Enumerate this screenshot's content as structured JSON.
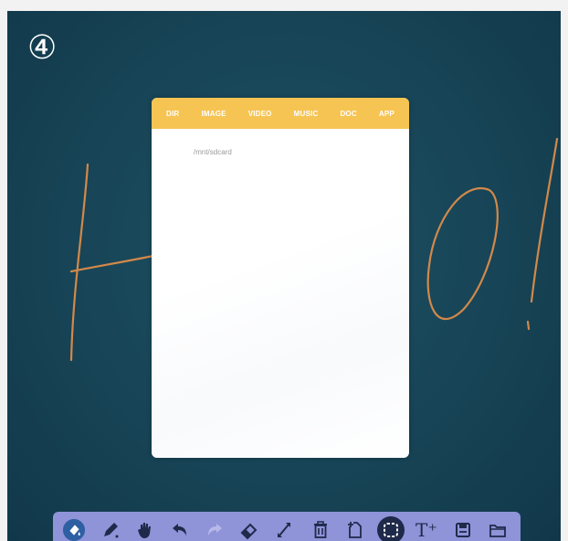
{
  "step_marker": "④",
  "dialog": {
    "tabs": [
      "DIR",
      "IMAGE",
      "VIDEO",
      "MUSIC",
      "DOC",
      "APP"
    ],
    "active_tab": "DIR",
    "path": "/mnt/sdcard",
    "header_color": "#f6c453"
  },
  "ink_color": "#d2894a",
  "toolbar": {
    "background": "#8f93d8",
    "tools": [
      {
        "name": "paint-fill-icon"
      },
      {
        "name": "pen-icon"
      },
      {
        "name": "hand-icon"
      },
      {
        "name": "undo-icon"
      },
      {
        "name": "redo-icon"
      },
      {
        "name": "eraser-icon"
      },
      {
        "name": "move-icon"
      },
      {
        "name": "trash-icon"
      },
      {
        "name": "add-page-icon"
      },
      {
        "name": "select-icon"
      },
      {
        "name": "text-icon",
        "label": "T⁺"
      },
      {
        "name": "save-icon"
      },
      {
        "name": "folder-icon"
      }
    ]
  }
}
